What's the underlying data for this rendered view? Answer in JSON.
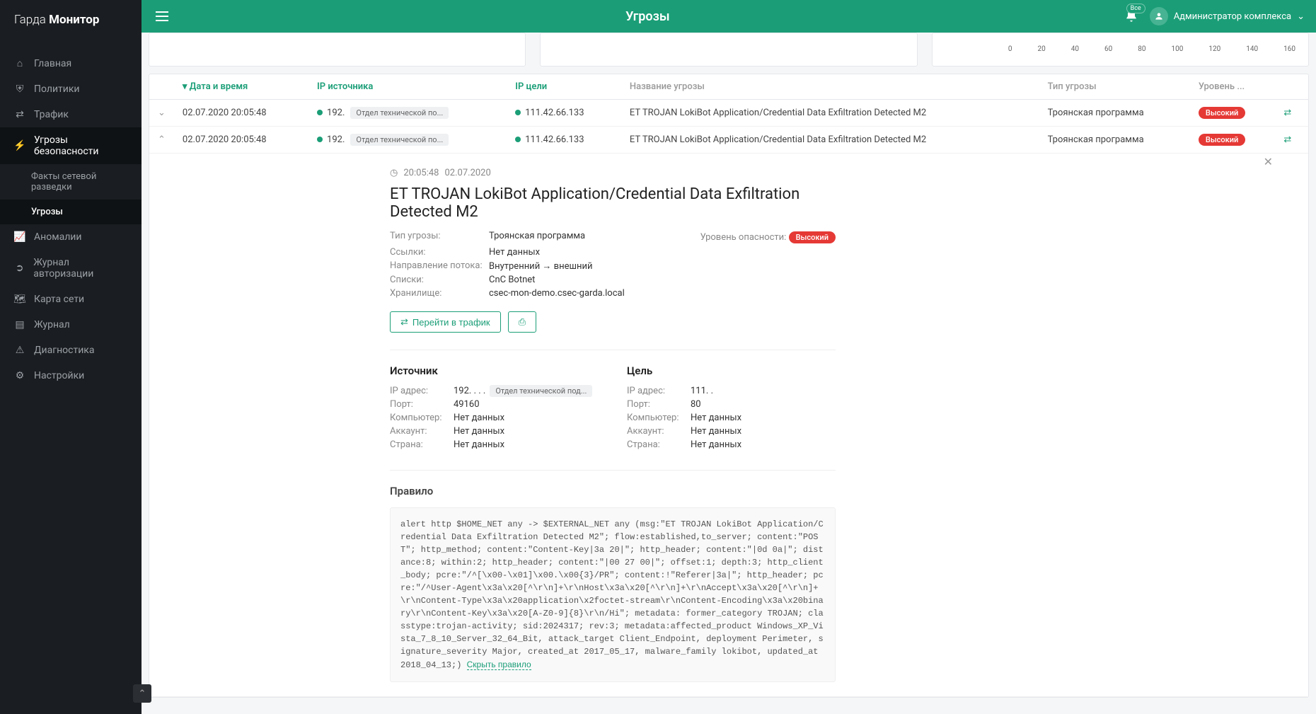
{
  "brand": {
    "part1": "Гарда",
    "part2": "Монитор"
  },
  "header": {
    "title": "Угрозы",
    "badge": "Все",
    "user": "Администратор комплекса"
  },
  "nav": {
    "home": "Главная",
    "policies": "Политики",
    "traffic": "Трафик",
    "threats": "Угрозы безопасности",
    "recon": "Факты сетевой разведки",
    "threats_sub": "Угрозы",
    "anomalies": "Аномалии",
    "auth_log": "Журнал авторизации",
    "netmap": "Карта сети",
    "journal": "Журнал",
    "diag": "Диагностика",
    "settings": "Настройки"
  },
  "axis": {
    "t0": "0",
    "t1": "20",
    "t2": "40",
    "t3": "60",
    "t4": "80",
    "t5": "100",
    "t6": "120",
    "t7": "140",
    "t8": "160"
  },
  "table": {
    "headers": {
      "datetime": "Дата и время",
      "src_ip": "IP источника",
      "tgt_ip": "IP цели",
      "name": "Название угрозы",
      "type": "Тип угрозы",
      "level": "Уровень ..."
    },
    "rows": [
      {
        "datetime": "02.07.2020 20:05:48",
        "src_ip": "192.",
        "dept": "Отдел технической по...",
        "tgt_ip": "111.42.66.133",
        "name": "ET TROJAN LokiBot Application/Credential Data Exfiltration Detected M2",
        "type": "Троянская программа",
        "level": "Высокий"
      },
      {
        "datetime": "02.07.2020 20:05:48",
        "src_ip": "192.",
        "dept": "Отдел технической по...",
        "tgt_ip": "111.42.66.133",
        "name": "ET TROJAN LokiBot Application/Credential Data Exfiltration Detected M2",
        "type": "Троянская программа",
        "level": "Высокий"
      }
    ]
  },
  "detail": {
    "time": "20:05:48",
    "date": "02.07.2020",
    "title": "ET TROJAN LokiBot Application/Credential Data Exfiltration Detected M2",
    "type_label": "Тип угрозы:",
    "type": "Троянская программа",
    "risk_label": "Уровень опасности:",
    "risk": "Высокий",
    "links_label": "Ссылки:",
    "links": "Нет данных",
    "flow_label": "Направление потока:",
    "flow": "Внутренний → внешний",
    "lists_label": "Списки:",
    "lists": "CnC Botnet",
    "storage_label": "Хранилище:",
    "storage": "csec-mon-demo.csec-garda.local",
    "btn_traffic": "Перейти в трафик",
    "src_title": "Источник",
    "tgt_title": "Цель",
    "ip_label": "IP адрес:",
    "port_label": "Порт:",
    "computer_label": "Компьютер:",
    "account_label": "Аккаунт:",
    "country_label": "Страна:",
    "src": {
      "ip": "192. . . .",
      "dept": "Отдел технической под...",
      "port": "49160",
      "computer": "Нет данных",
      "account": "Нет данных",
      "country": "Нет данных"
    },
    "tgt": {
      "ip": "111. .",
      "port": "80",
      "computer": "Нет данных",
      "account": "Нет данных",
      "country": "Нет данных"
    },
    "rule_title": "Правило",
    "rule_text": "alert http $HOME_NET any -> $EXTERNAL_NET any (msg:\"ET TROJAN LokiBot Application/Credential Data Exfiltration Detected M2\"; flow:established,to_server; content:\"POST\"; http_method; content:\"Content-Key|3a 20|\"; http_header; content:\"|0d 0a|\"; distance:8; within:2; http_header; content:\"|00 27 00|\"; offset:1; depth:3; http_client_body; pcre:\"/^[\\x00-\\x01]\\x00.\\x00{3}/PR\"; content:!\"Referer|3a|\"; http_header; pcre:\"/^User-Agent\\x3a\\x20[^\\r\\n]+\\r\\nHost\\x3a\\x20[^\\r\\n]+\\r\\nAccept\\x3a\\x20[^\\r\\n]+\\r\\nContent-Type\\x3a\\x20application\\x2foctet-stream\\r\\nContent-Encoding\\x3a\\x20binary\\r\\nContent-Key\\x3a\\x20[A-Z0-9]{8}\\r\\n/Hi\"; metadata: former_category TROJAN; classtype:trojan-activity; sid:2024317; rev:3; metadata:affected_product Windows_XP_Vista_7_8_10_Server_32_64_Bit, attack_target Client_Endpoint, deployment Perimeter, signature_severity Major, created_at 2017_05_17, malware_family lokibot, updated_at 2018_04_13;) ",
    "rule_link": "Скрыть правило"
  }
}
